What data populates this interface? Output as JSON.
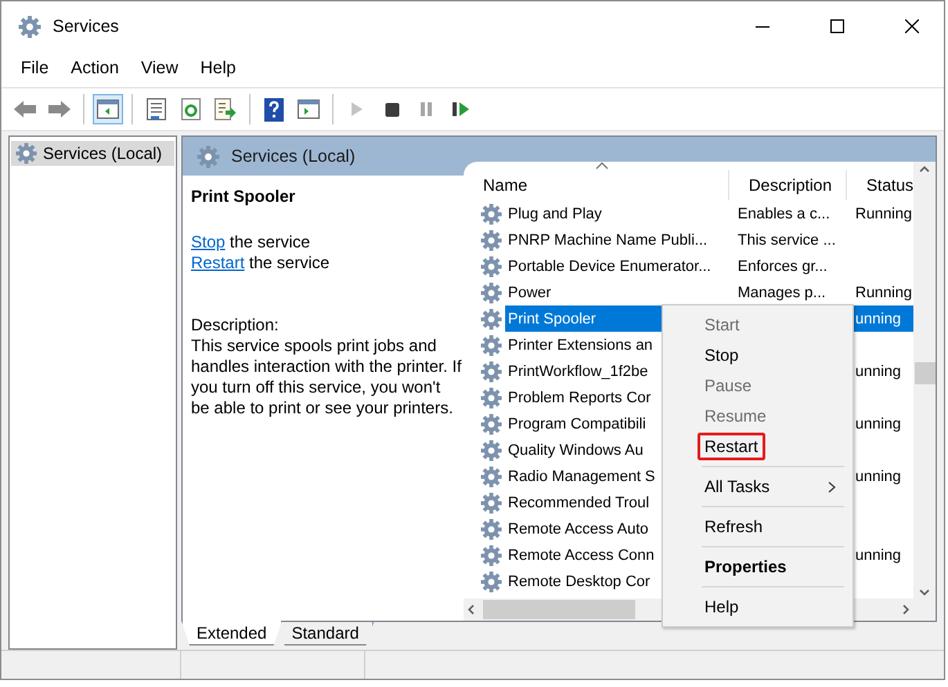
{
  "window": {
    "title": "Services"
  },
  "menu_bar": [
    "File",
    "Action",
    "View",
    "Help"
  ],
  "toolbar": [
    [
      {
        "kind": "back",
        "pressed": false,
        "disabled": false
      },
      {
        "kind": "forward",
        "pressed": false,
        "disabled": false
      }
    ],
    [
      {
        "kind": "tree",
        "pressed": true,
        "disabled": false
      }
    ],
    [
      {
        "kind": "properties",
        "pressed": false,
        "disabled": false
      },
      {
        "kind": "refresh",
        "pressed": false,
        "disabled": false
      },
      {
        "kind": "export",
        "pressed": false,
        "disabled": false
      }
    ],
    [
      {
        "kind": "help",
        "pressed": false,
        "disabled": false
      },
      {
        "kind": "pane",
        "pressed": false,
        "disabled": false
      }
    ],
    [
      {
        "kind": "play",
        "pressed": false,
        "disabled": true
      },
      {
        "kind": "stop",
        "pressed": false,
        "disabled": false
      },
      {
        "kind": "pause",
        "pressed": false,
        "disabled": true
      },
      {
        "kind": "restart",
        "pressed": false,
        "disabled": false
      }
    ]
  ],
  "tree": {
    "items": [
      {
        "label": "Services (Local)",
        "selected": true
      }
    ]
  },
  "pane_header": "Services (Local)",
  "details": {
    "title": "Print Spooler",
    "actions": [
      {
        "link": "Stop",
        "text": "the service"
      },
      {
        "link": "Restart",
        "text": "the service"
      }
    ],
    "description_label": "Description:",
    "description": "This service spools print jobs and handles interaction with the printer. If you turn off this service, you won't be able to print or see your printers."
  },
  "table": {
    "columns": [
      "Name",
      "Description",
      "Status"
    ],
    "rows": [
      {
        "name": "Plug and Play",
        "description": "Enables a c...",
        "status": "Running",
        "selected": false
      },
      {
        "name": "PNRP Machine Name Publi...",
        "description": "This service ...",
        "status": "",
        "selected": false
      },
      {
        "name": "Portable Device Enumerator...",
        "description": "Enforces gr...",
        "status": "",
        "selected": false
      },
      {
        "name": "Power",
        "description": "Manages p...",
        "status": "Running",
        "selected": false
      },
      {
        "name": "Print Spooler",
        "description": "",
        "status": "unning",
        "selected": true
      },
      {
        "name": "Printer Extensions an",
        "description": "",
        "status": "",
        "selected": false
      },
      {
        "name": "PrintWorkflow_1f2be",
        "description": "",
        "status": "unning",
        "selected": false
      },
      {
        "name": "Problem Reports Cor",
        "description": "",
        "status": "",
        "selected": false
      },
      {
        "name": "Program Compatibili",
        "description": "",
        "status": "unning",
        "selected": false
      },
      {
        "name": "Quality Windows Au",
        "description": "",
        "status": "",
        "selected": false
      },
      {
        "name": "Radio Management S",
        "description": "",
        "status": "unning",
        "selected": false
      },
      {
        "name": "Recommended Troul",
        "description": "",
        "status": "",
        "selected": false
      },
      {
        "name": "Remote Access Auto",
        "description": "",
        "status": "",
        "selected": false
      },
      {
        "name": "Remote Access Conn",
        "description": "",
        "status": "unning",
        "selected": false
      },
      {
        "name": "Remote Desktop Cor",
        "description": "",
        "status": "",
        "selected": false
      }
    ]
  },
  "context_menu": [
    {
      "kind": "item",
      "label": "Start",
      "disabled": true,
      "bold": false,
      "submenu": false,
      "outlined": false
    },
    {
      "kind": "item",
      "label": "Stop",
      "disabled": false,
      "bold": false,
      "submenu": false,
      "outlined": false
    },
    {
      "kind": "item",
      "label": "Pause",
      "disabled": true,
      "bold": false,
      "submenu": false,
      "outlined": false
    },
    {
      "kind": "item",
      "label": "Resume",
      "disabled": true,
      "bold": false,
      "submenu": false,
      "outlined": false
    },
    {
      "kind": "item",
      "label": "Restart",
      "disabled": false,
      "bold": false,
      "submenu": false,
      "outlined": true
    },
    {
      "kind": "separator"
    },
    {
      "kind": "item",
      "label": "All Tasks",
      "disabled": false,
      "bold": false,
      "submenu": true,
      "outlined": false
    },
    {
      "kind": "separator"
    },
    {
      "kind": "item",
      "label": "Refresh",
      "disabled": false,
      "bold": false,
      "submenu": false,
      "outlined": false
    },
    {
      "kind": "separator"
    },
    {
      "kind": "item",
      "label": "Properties",
      "disabled": false,
      "bold": true,
      "submenu": false,
      "outlined": false
    },
    {
      "kind": "separator"
    },
    {
      "kind": "item",
      "label": "Help",
      "disabled": false,
      "bold": false,
      "submenu": false,
      "outlined": false
    }
  ],
  "view_tabs": [
    {
      "label": "Extended",
      "selected": true
    },
    {
      "label": "Standard",
      "selected": false
    }
  ]
}
